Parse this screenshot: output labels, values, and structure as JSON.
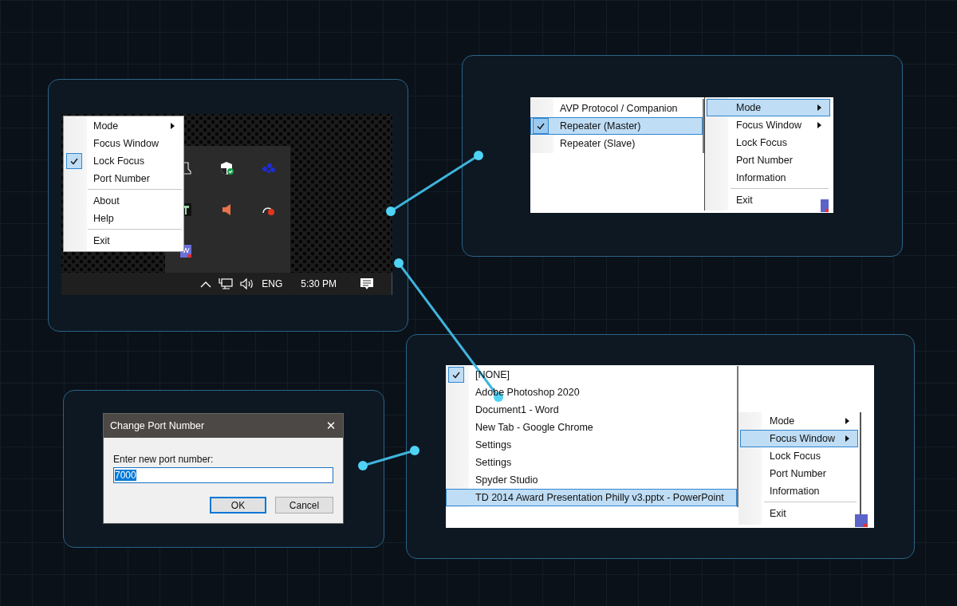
{
  "tray_panel": {
    "menu": {
      "items": [
        {
          "kind": "item",
          "label": "Mode",
          "submenu": true,
          "checked": false,
          "selected": false
        },
        {
          "kind": "item",
          "label": "Focus Window",
          "submenu": false,
          "checked": false,
          "selected": false
        },
        {
          "kind": "item",
          "label": "Lock Focus",
          "submenu": false,
          "checked": true,
          "selected": false
        },
        {
          "kind": "item",
          "label": "Port Number",
          "submenu": false,
          "checked": false,
          "selected": false
        },
        {
          "kind": "separator"
        },
        {
          "kind": "item",
          "label": "About",
          "submenu": false,
          "checked": false,
          "selected": false
        },
        {
          "kind": "item",
          "label": "Help",
          "submenu": false,
          "checked": false,
          "selected": false
        },
        {
          "kind": "separator"
        },
        {
          "kind": "item",
          "label": "Exit",
          "submenu": false,
          "checked": false,
          "selected": false
        }
      ]
    },
    "taskbar": {
      "language": "ENG",
      "time": "5:30 PM"
    }
  },
  "mode_panel": {
    "submenu": {
      "items": [
        {
          "kind": "item",
          "label": "AVP Protocol / Companion",
          "submenu": false,
          "checked": false,
          "selected": false
        },
        {
          "kind": "item",
          "label": "Repeater (Master)",
          "submenu": false,
          "checked": true,
          "selected": true
        },
        {
          "kind": "item",
          "label": "Repeater (Slave)",
          "submenu": false,
          "checked": false,
          "selected": false
        }
      ]
    },
    "menu": {
      "items": [
        {
          "kind": "item",
          "label": "Mode",
          "submenu": true,
          "checked": false,
          "selected": true
        },
        {
          "kind": "item",
          "label": "Focus Window",
          "submenu": true,
          "checked": false,
          "selected": false
        },
        {
          "kind": "item",
          "label": "Lock Focus",
          "submenu": false,
          "checked": false,
          "selected": false
        },
        {
          "kind": "item",
          "label": "Port Number",
          "submenu": false,
          "checked": false,
          "selected": false
        },
        {
          "kind": "item",
          "label": "Information",
          "submenu": false,
          "checked": false,
          "selected": false
        },
        {
          "kind": "separator"
        },
        {
          "kind": "item",
          "label": "Exit",
          "submenu": false,
          "checked": false,
          "selected": false
        }
      ]
    }
  },
  "focus_panel": {
    "submenu": {
      "items": [
        {
          "kind": "item",
          "label": "[NONE]",
          "submenu": false,
          "checked": true,
          "selected": false
        },
        {
          "kind": "item",
          "label": "Adobe Photoshop 2020",
          "submenu": false,
          "checked": false,
          "selected": false
        },
        {
          "kind": "item",
          "label": "Document1 - Word",
          "submenu": false,
          "checked": false,
          "selected": false
        },
        {
          "kind": "item",
          "label": "New Tab - Google Chrome",
          "submenu": false,
          "checked": false,
          "selected": false
        },
        {
          "kind": "item",
          "label": "Settings",
          "submenu": false,
          "checked": false,
          "selected": false
        },
        {
          "kind": "item",
          "label": "Settings",
          "submenu": false,
          "checked": false,
          "selected": false
        },
        {
          "kind": "item",
          "label": "Spyder Studio",
          "submenu": false,
          "checked": false,
          "selected": false
        },
        {
          "kind": "item",
          "label": "TD 2014 Award Presentation Philly v3.pptx - PowerPoint",
          "submenu": false,
          "checked": false,
          "selected": true
        }
      ]
    },
    "menu": {
      "items": [
        {
          "kind": "item",
          "label": "Mode",
          "submenu": true,
          "checked": false,
          "selected": false
        },
        {
          "kind": "item",
          "label": "Focus Window",
          "submenu": true,
          "checked": false,
          "selected": true
        },
        {
          "kind": "item",
          "label": "Lock Focus",
          "submenu": false,
          "checked": false,
          "selected": false
        },
        {
          "kind": "item",
          "label": "Port Number",
          "submenu": false,
          "checked": false,
          "selected": false
        },
        {
          "kind": "item",
          "label": "Information",
          "submenu": false,
          "checked": false,
          "selected": false
        },
        {
          "kind": "separator"
        },
        {
          "kind": "item",
          "label": "Exit",
          "submenu": false,
          "checked": false,
          "selected": false
        }
      ]
    }
  },
  "port_dialog": {
    "title": "Change Port Number",
    "close": "✕",
    "prompt": "Enter new port number:",
    "value": "7000",
    "buttons": [
      {
        "label": "OK",
        "default": true
      },
      {
        "label": "Cancel",
        "default": false
      }
    ]
  }
}
